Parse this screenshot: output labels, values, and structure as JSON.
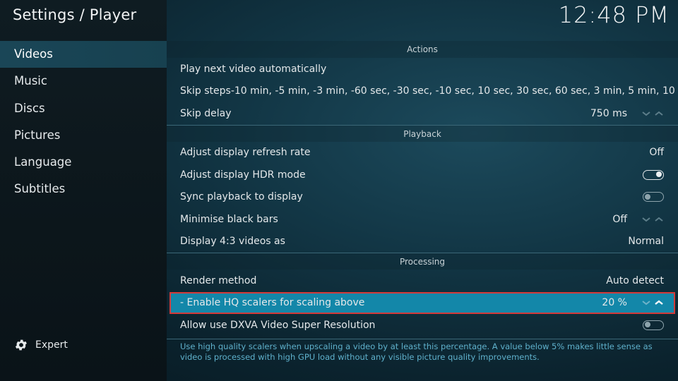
{
  "header": {
    "title": "Settings / Player",
    "clock": "12:48 PM"
  },
  "sidebar": {
    "items": [
      {
        "label": "Videos",
        "active": true
      },
      {
        "label": "Music"
      },
      {
        "label": "Discs"
      },
      {
        "label": "Pictures"
      },
      {
        "label": "Language"
      },
      {
        "label": "Subtitles"
      }
    ],
    "level_label": "Expert",
    "level_icon": "gear-icon"
  },
  "sections": {
    "actions": {
      "title": "Actions",
      "play_next": {
        "label": "Play next video automatically"
      },
      "skip_steps": {
        "label": "Skip steps",
        "value": "-10 min, -5 min, -3 min, -60 sec, -30 sec, -10 sec, 10 sec, 30 sec, 60 sec, 3 min, 5 min, 10 min"
      },
      "skip_delay": {
        "label": "Skip delay",
        "value": "750 ms"
      }
    },
    "playback": {
      "title": "Playback",
      "refresh_rate": {
        "label": "Adjust display refresh rate",
        "value": "Off"
      },
      "hdr_mode": {
        "label": "Adjust display HDR mode",
        "enabled": true
      },
      "sync_playback": {
        "label": "Sync playback to display",
        "enabled": false
      },
      "black_bars": {
        "label": "Minimise black bars",
        "value": "Off"
      },
      "display_43": {
        "label": "Display 4:3 videos as",
        "value": "Normal"
      }
    },
    "processing": {
      "title": "Processing",
      "render_method": {
        "label": "Render method",
        "value": "Auto detect"
      },
      "hq_scalers": {
        "label": "- Enable HQ scalers for scaling above",
        "value": "20 %",
        "focused": true
      },
      "dxva_super_res": {
        "label": "Allow use DXVA Video Super Resolution",
        "enabled": false
      }
    }
  },
  "help_text": "Use high quality scalers when upscaling a video by at least this percentage. A value below 5% makes little sense as video is processed with high GPU load without any visible picture quality improvements.",
  "colors": {
    "focus_bg": "#1387a9",
    "focus_border": "#d23b3b",
    "help_text": "#5fb1cc",
    "divider": "#3b6777"
  }
}
